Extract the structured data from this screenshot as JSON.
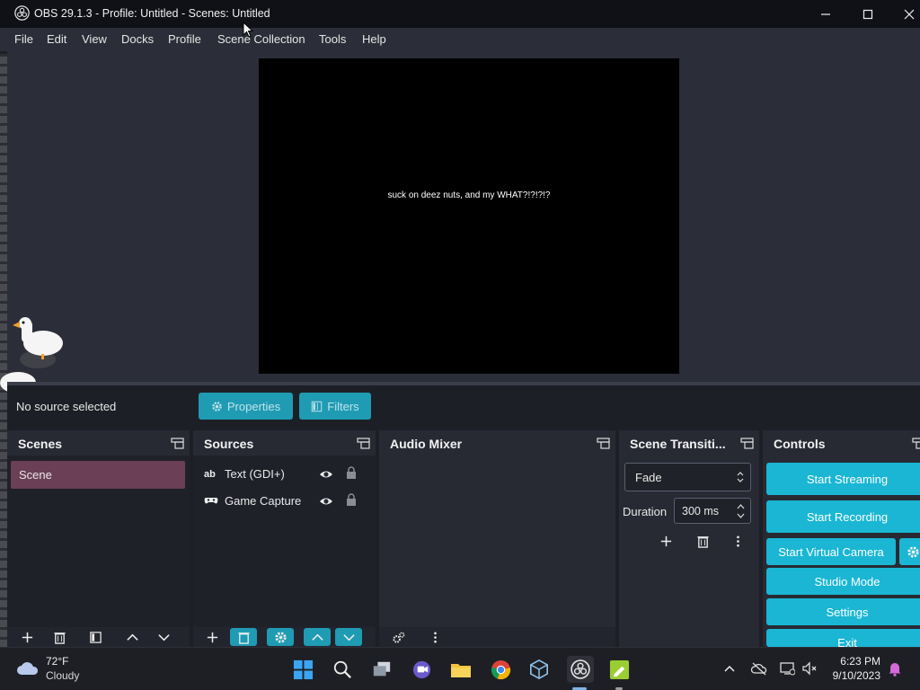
{
  "window": {
    "title": "OBS 29.1.3 - Profile: Untitled - Scenes: Untitled"
  },
  "menu": [
    "File",
    "Edit",
    "View",
    "Docks",
    "Profile",
    "Scene Collection",
    "Tools",
    "Help"
  ],
  "preview": {
    "canvas_text": "suck on deez nuts, and my WHAT?!?!?!?"
  },
  "properties_bar": {
    "status": "No source selected",
    "properties_label": "Properties",
    "filters_label": "Filters"
  },
  "scenes": {
    "title": "Scenes",
    "items": [
      "Scene"
    ]
  },
  "sources": {
    "title": "Sources",
    "items": [
      {
        "label": "Text (GDI+)",
        "icon": "text-icon"
      },
      {
        "label": "Game Capture",
        "icon": "gamepad-icon"
      }
    ]
  },
  "audio_mixer": {
    "title": "Audio Mixer"
  },
  "transitions": {
    "title": "Scene Transiti...",
    "selected": "Fade",
    "duration_label": "Duration",
    "duration_value": "300 ms"
  },
  "controls": {
    "title": "Controls",
    "start_streaming": "Start Streaming",
    "start_recording": "Start Recording",
    "start_virtual_camera": "Start Virtual Camera",
    "studio_mode": "Studio Mode",
    "settings": "Settings",
    "exit": "Exit"
  },
  "taskbar": {
    "temperature": "72°F",
    "condition": "Cloudy",
    "time": "6:23 PM",
    "date": "9/10/2023"
  },
  "colors": {
    "accent": "#1ab6d4",
    "scene_selected": "#6b3f55",
    "background": "#1d1f26"
  }
}
